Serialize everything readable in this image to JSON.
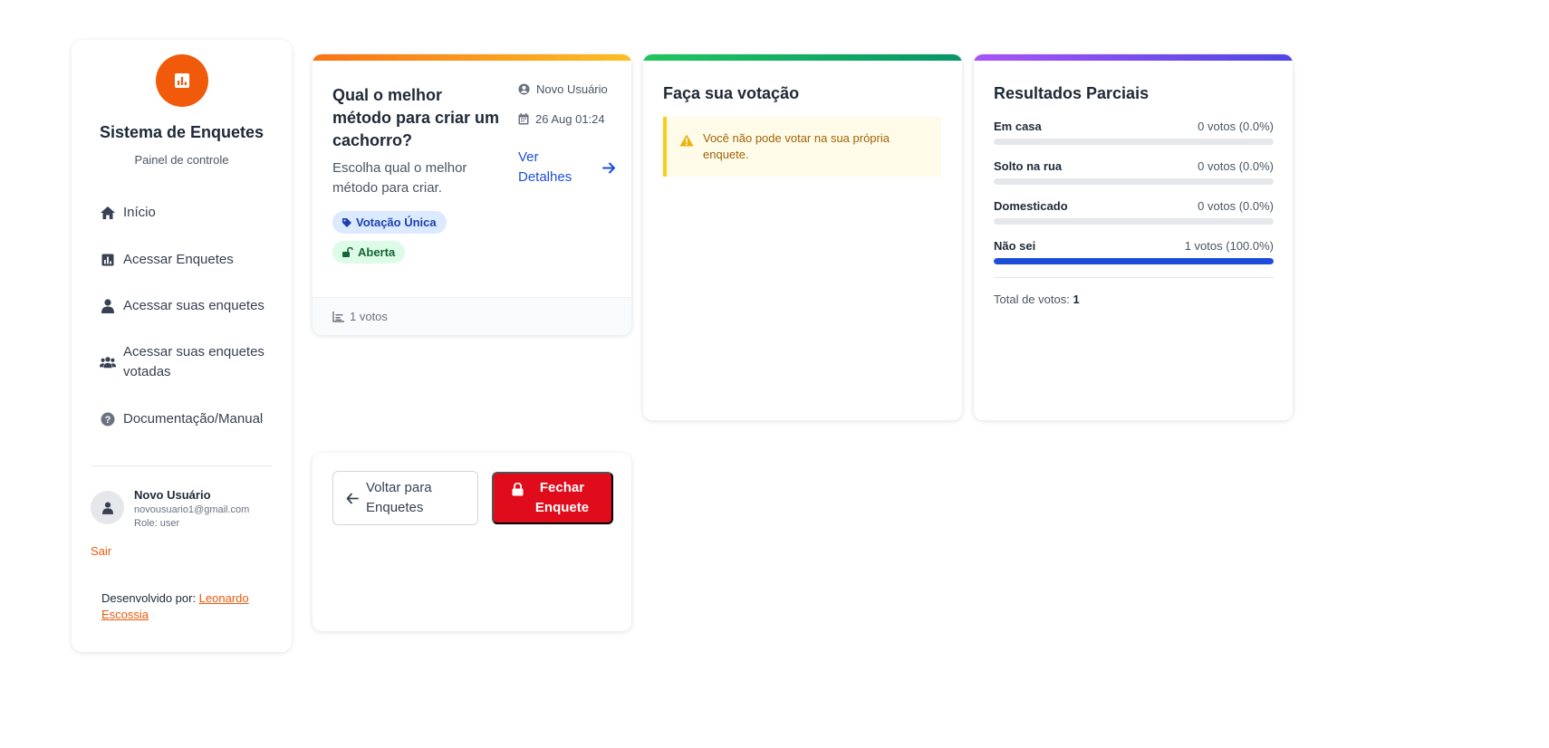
{
  "sidebar": {
    "app_title": "Sistema de Enquetes",
    "app_subtitle": "Painel de controle",
    "nav": [
      {
        "label": "Início",
        "icon": "home-icon"
      },
      {
        "label": "Acessar Enquetes",
        "icon": "bar-chart-icon"
      },
      {
        "label": "Acessar suas enquetes",
        "icon": "user-icon"
      },
      {
        "label": "Acessar suas enquetes votadas",
        "icon": "users-icon"
      },
      {
        "label": "Documentação/Manual",
        "icon": "question-circle-icon"
      }
    ],
    "user": {
      "name": "Novo Usuário",
      "email": "novousuario1@gmail.com",
      "role": "Role: user"
    },
    "logout_label": "Sair",
    "credits_prefix": "Desenvolvido por: ",
    "credits_link": "Leonardo Escossia",
    "accent_color": "#f05a0a"
  },
  "poll": {
    "title": "Qual o melhor método para criar um cachorro?",
    "description": "Escolha qual o melhor método para criar.",
    "author": "Novo Usuário",
    "date": "26 Aug 01:24",
    "details_label": "Ver Detalhes",
    "type_badge": "Votação Única",
    "status_badge": "Aberta",
    "votes_footer": "1 votos"
  },
  "vote": {
    "heading": "Faça sua votação",
    "warning": "Você não pode votar na sua própria enquete."
  },
  "results": {
    "heading": "Resultados Parciais",
    "options": [
      {
        "label": "Em casa",
        "value": "0 votos (0.0%)",
        "fraction": 0
      },
      {
        "label": "Solto na rua",
        "value": "0 votos (0.0%)",
        "fraction": 0
      },
      {
        "label": "Domesticado",
        "value": "0 votos (0.0%)",
        "fraction": 0
      },
      {
        "label": "Não sei",
        "value": "1 votos (100.0%)",
        "fraction": 1
      }
    ],
    "total_label": "Total de votos:",
    "total_value": "1"
  },
  "actions": {
    "back_label": "Voltar para Enquetes",
    "close_label": "Fechar Enquete"
  },
  "colors": {
    "poll_bar": "#f97316",
    "vote_bar": "#22c55e",
    "results_bar": "#a855f7",
    "primary_blue": "#1d4ed8",
    "danger_red": "#e00b1b"
  }
}
